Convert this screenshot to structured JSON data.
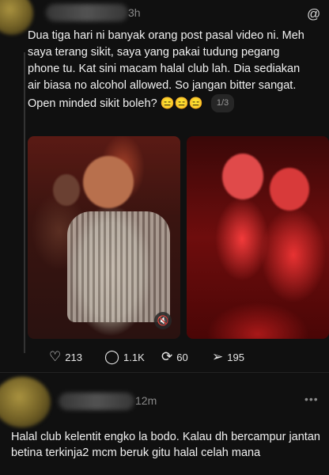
{
  "post": {
    "time": "3h",
    "text": "Dua tiga hari ni banyak orang post pasal video ni. Meh saya terang sikit, saya yang pakai tudung pegang phone tu. Kat sini macam halal club lah. Dia sediakan air biasa no alcohol allowed. So jangan bitter sangat. Open minded sikit boleh? 😑😑😑",
    "page_indicator": "1/3",
    "likes": "213",
    "comments": "1.1K",
    "reposts": "60",
    "shares": "195"
  },
  "reply": {
    "time": "12m",
    "text": "Halal club kelentit engko la bodo. Kalau dh bercampur jantan betina terkinja2 mcm beruk gitu halal celah mana"
  },
  "icons": {
    "threads_logo": "threads-logo-icon",
    "like": "heart-icon",
    "comment": "comment-icon",
    "repost": "repost-icon",
    "share": "share-icon",
    "mute": "mute-icon",
    "more": "more-icon"
  }
}
